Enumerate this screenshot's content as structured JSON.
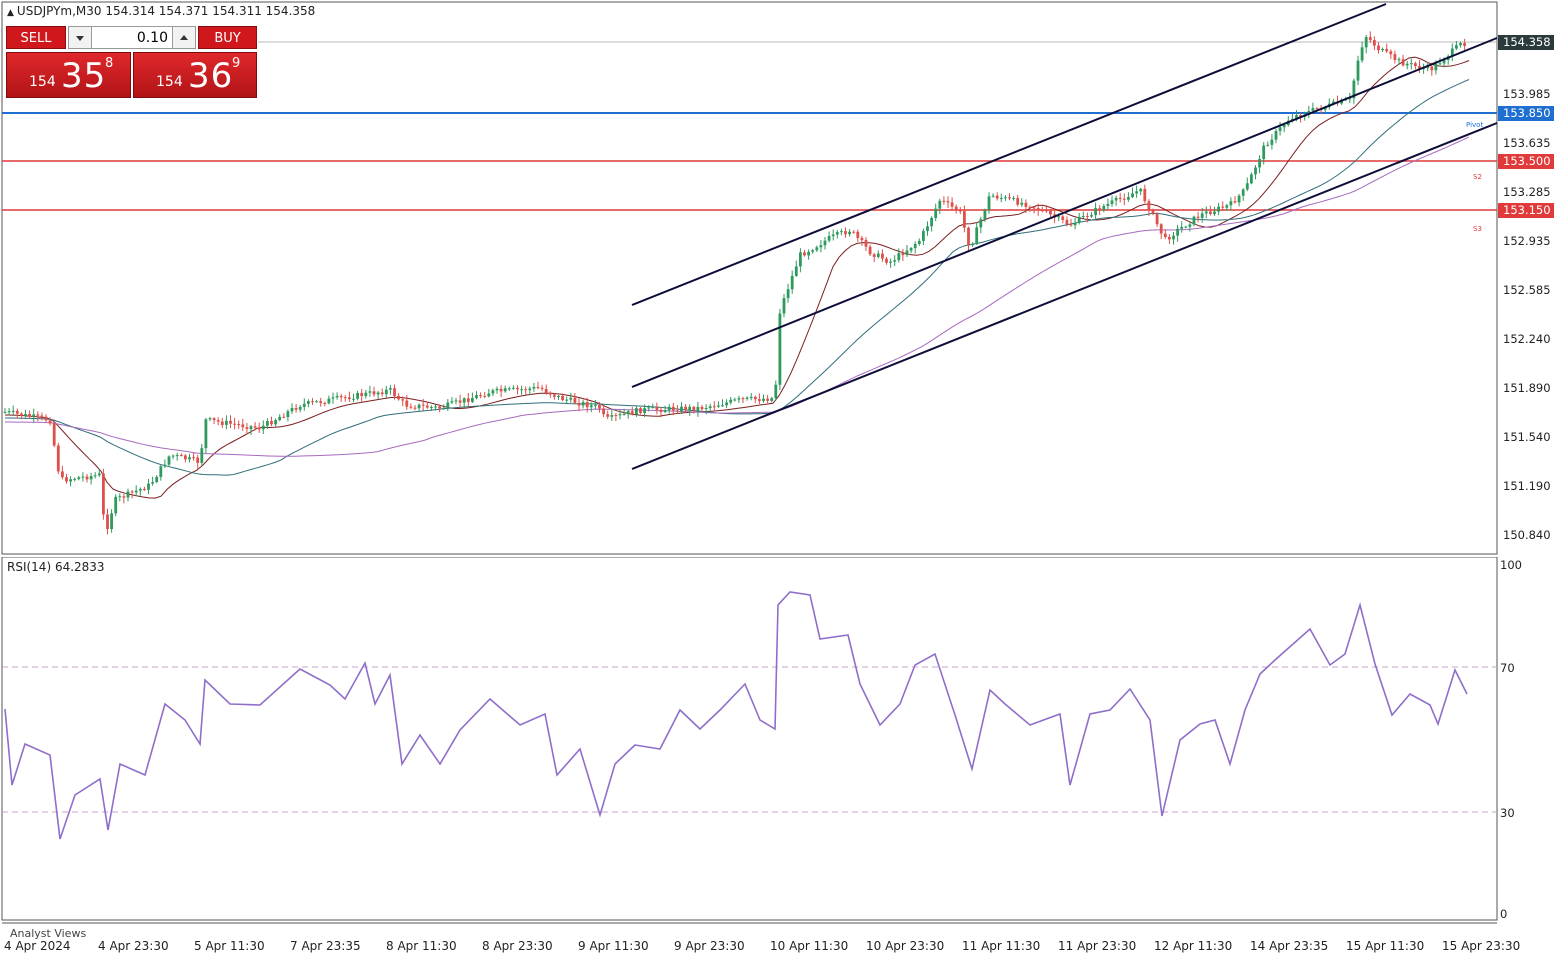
{
  "header": {
    "symbol_info": "USDJPYm,M30  154.314 154.371 154.311 154.358"
  },
  "trade_panel": {
    "sell_label": "SELL",
    "buy_label": "BUY",
    "volume": "0.10",
    "sell_price_small": "154",
    "sell_price_big": "35",
    "sell_price_sup": "8",
    "buy_price_small": "154",
    "buy_price_big": "36",
    "buy_price_sup": "9"
  },
  "price_axis": {
    "labels": [
      "153.985",
      "153.635",
      "153.285",
      "152.935",
      "152.585",
      "152.240",
      "151.890",
      "151.540",
      "151.190",
      "150.840"
    ],
    "current_price": "154.358",
    "levels": [
      {
        "price": "153.850",
        "color": "#1e6fd0",
        "note": "Pivot"
      },
      {
        "price": "153.500",
        "color": "#e03a3a",
        "note": "S2"
      },
      {
        "price": "153.150",
        "color": "#e03a3a",
        "note": "S3"
      }
    ]
  },
  "time_axis": {
    "labels": [
      "4 Apr 2024",
      "4 Apr 23:30",
      "5 Apr 11:30",
      "7 Apr 23:35",
      "8 Apr 11:30",
      "8 Apr 23:30",
      "9 Apr 11:30",
      "9 Apr 23:30",
      "10 Apr 11:30",
      "10 Apr 23:30",
      "11 Apr 11:30",
      "11 Apr 23:30",
      "12 Apr 11:30",
      "14 Apr 23:35",
      "15 Apr 11:30",
      "15 Apr 23:30"
    ]
  },
  "rsi": {
    "title": "RSI(14) 64.2833",
    "axis_labels": [
      "100",
      "70",
      "30",
      "0"
    ]
  },
  "footer": {
    "analyst_views": "Analyst Views"
  },
  "colors": {
    "bull": "#2e9a5e",
    "bear": "#e0504a",
    "ma_fast": "#7a1f1f",
    "ma_mid": "#2f6f7a",
    "ma_slow": "#a86ac0",
    "channel": "#0d0d3a",
    "rsi_line": "#8f6ec9"
  }
}
